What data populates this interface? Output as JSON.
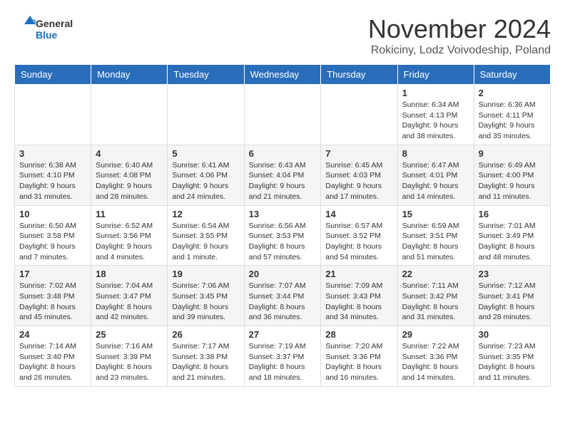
{
  "logo": {
    "general": "General",
    "blue": "Blue"
  },
  "title": "November 2024",
  "location": "Rokiciny, Lodz Voivodeship, Poland",
  "days_of_week": [
    "Sunday",
    "Monday",
    "Tuesday",
    "Wednesday",
    "Thursday",
    "Friday",
    "Saturday"
  ],
  "weeks": [
    [
      {
        "day": "",
        "info": ""
      },
      {
        "day": "",
        "info": ""
      },
      {
        "day": "",
        "info": ""
      },
      {
        "day": "",
        "info": ""
      },
      {
        "day": "",
        "info": ""
      },
      {
        "day": "1",
        "info": "Sunrise: 6:34 AM\nSunset: 4:13 PM\nDaylight: 9 hours\nand 38 minutes."
      },
      {
        "day": "2",
        "info": "Sunrise: 6:36 AM\nSunset: 4:11 PM\nDaylight: 9 hours\nand 35 minutes."
      }
    ],
    [
      {
        "day": "3",
        "info": "Sunrise: 6:38 AM\nSunset: 4:10 PM\nDaylight: 9 hours\nand 31 minutes."
      },
      {
        "day": "4",
        "info": "Sunrise: 6:40 AM\nSunset: 4:08 PM\nDaylight: 9 hours\nand 28 minutes."
      },
      {
        "day": "5",
        "info": "Sunrise: 6:41 AM\nSunset: 4:06 PM\nDaylight: 9 hours\nand 24 minutes."
      },
      {
        "day": "6",
        "info": "Sunrise: 6:43 AM\nSunset: 4:04 PM\nDaylight: 9 hours\nand 21 minutes."
      },
      {
        "day": "7",
        "info": "Sunrise: 6:45 AM\nSunset: 4:03 PM\nDaylight: 9 hours\nand 17 minutes."
      },
      {
        "day": "8",
        "info": "Sunrise: 6:47 AM\nSunset: 4:01 PM\nDaylight: 9 hours\nand 14 minutes."
      },
      {
        "day": "9",
        "info": "Sunrise: 6:49 AM\nSunset: 4:00 PM\nDaylight: 9 hours\nand 11 minutes."
      }
    ],
    [
      {
        "day": "10",
        "info": "Sunrise: 6:50 AM\nSunset: 3:58 PM\nDaylight: 9 hours\nand 7 minutes."
      },
      {
        "day": "11",
        "info": "Sunrise: 6:52 AM\nSunset: 3:56 PM\nDaylight: 9 hours\nand 4 minutes."
      },
      {
        "day": "12",
        "info": "Sunrise: 6:54 AM\nSunset: 3:55 PM\nDaylight: 9 hours\nand 1 minute."
      },
      {
        "day": "13",
        "info": "Sunrise: 6:56 AM\nSunset: 3:53 PM\nDaylight: 8 hours\nand 57 minutes."
      },
      {
        "day": "14",
        "info": "Sunrise: 6:57 AM\nSunset: 3:52 PM\nDaylight: 8 hours\nand 54 minutes."
      },
      {
        "day": "15",
        "info": "Sunrise: 6:59 AM\nSunset: 3:51 PM\nDaylight: 8 hours\nand 51 minutes."
      },
      {
        "day": "16",
        "info": "Sunrise: 7:01 AM\nSunset: 3:49 PM\nDaylight: 8 hours\nand 48 minutes."
      }
    ],
    [
      {
        "day": "17",
        "info": "Sunrise: 7:02 AM\nSunset: 3:48 PM\nDaylight: 8 hours\nand 45 minutes."
      },
      {
        "day": "18",
        "info": "Sunrise: 7:04 AM\nSunset: 3:47 PM\nDaylight: 8 hours\nand 42 minutes."
      },
      {
        "day": "19",
        "info": "Sunrise: 7:06 AM\nSunset: 3:45 PM\nDaylight: 8 hours\nand 39 minutes."
      },
      {
        "day": "20",
        "info": "Sunrise: 7:07 AM\nSunset: 3:44 PM\nDaylight: 8 hours\nand 36 minutes."
      },
      {
        "day": "21",
        "info": "Sunrise: 7:09 AM\nSunset: 3:43 PM\nDaylight: 8 hours\nand 34 minutes."
      },
      {
        "day": "22",
        "info": "Sunrise: 7:11 AM\nSunset: 3:42 PM\nDaylight: 8 hours\nand 31 minutes."
      },
      {
        "day": "23",
        "info": "Sunrise: 7:12 AM\nSunset: 3:41 PM\nDaylight: 8 hours\nand 28 minutes."
      }
    ],
    [
      {
        "day": "24",
        "info": "Sunrise: 7:14 AM\nSunset: 3:40 PM\nDaylight: 8 hours\nand 26 minutes."
      },
      {
        "day": "25",
        "info": "Sunrise: 7:16 AM\nSunset: 3:39 PM\nDaylight: 8 hours\nand 23 minutes."
      },
      {
        "day": "26",
        "info": "Sunrise: 7:17 AM\nSunset: 3:38 PM\nDaylight: 8 hours\nand 21 minutes."
      },
      {
        "day": "27",
        "info": "Sunrise: 7:19 AM\nSunset: 3:37 PM\nDaylight: 8 hours\nand 18 minutes."
      },
      {
        "day": "28",
        "info": "Sunrise: 7:20 AM\nSunset: 3:36 PM\nDaylight: 8 hours\nand 16 minutes."
      },
      {
        "day": "29",
        "info": "Sunrise: 7:22 AM\nSunset: 3:36 PM\nDaylight: 8 hours\nand 14 minutes."
      },
      {
        "day": "30",
        "info": "Sunrise: 7:23 AM\nSunset: 3:35 PM\nDaylight: 8 hours\nand 11 minutes."
      }
    ]
  ]
}
